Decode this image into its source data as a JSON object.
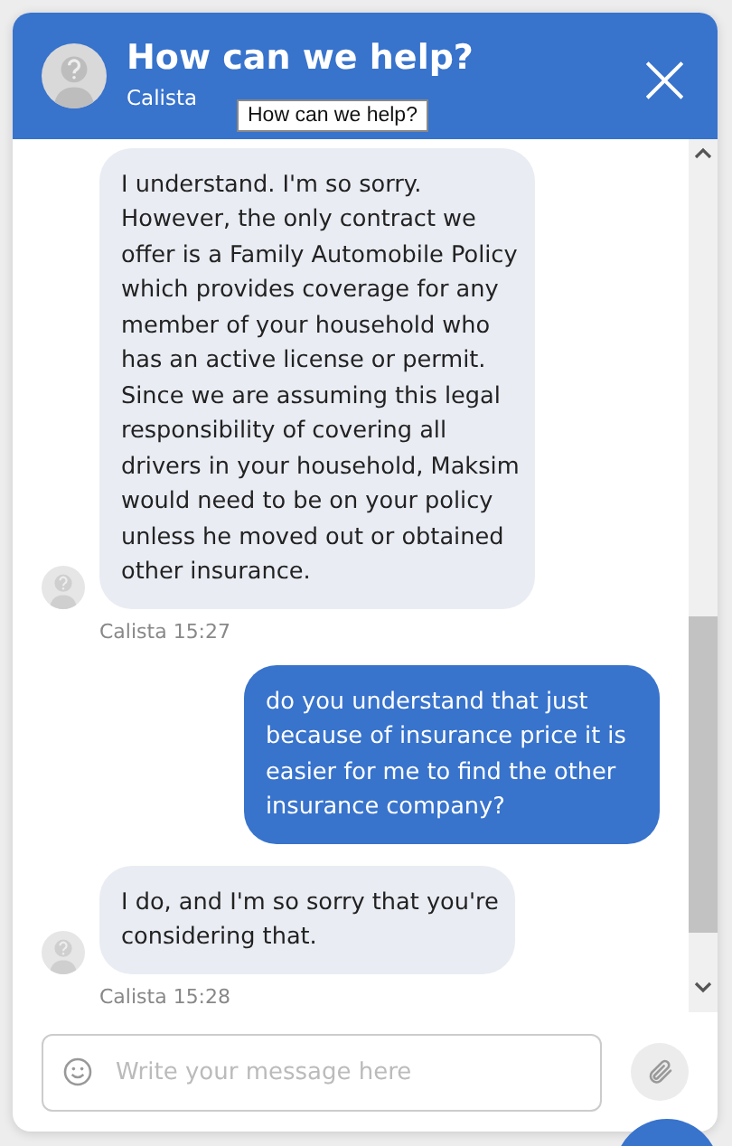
{
  "header": {
    "title": "How can we help?",
    "agent": "Calista",
    "tooltip": "How can we help?",
    "close": "×"
  },
  "messages": [
    {
      "kind": "agent",
      "text": "I understand. I'm so sorry. However, the only contract we offer is a Family Automobile Policy which provides coverage for any member of your household who has an active license or permit. Since we are assuming this legal responsibility of covering all drivers in your household, Maksim would need to be on your policy unless he moved out or obtained other insurance.",
      "meta": "Calista 15:27"
    },
    {
      "kind": "user",
      "text": "do you understand that just because of insurance price it is easier for me to find the other insurance company?"
    },
    {
      "kind": "agent",
      "text": "I do, and I'm so sorry that you're considering that.",
      "meta": "Calista 15:28"
    }
  ],
  "composer": {
    "placeholder": "Write your message here"
  }
}
